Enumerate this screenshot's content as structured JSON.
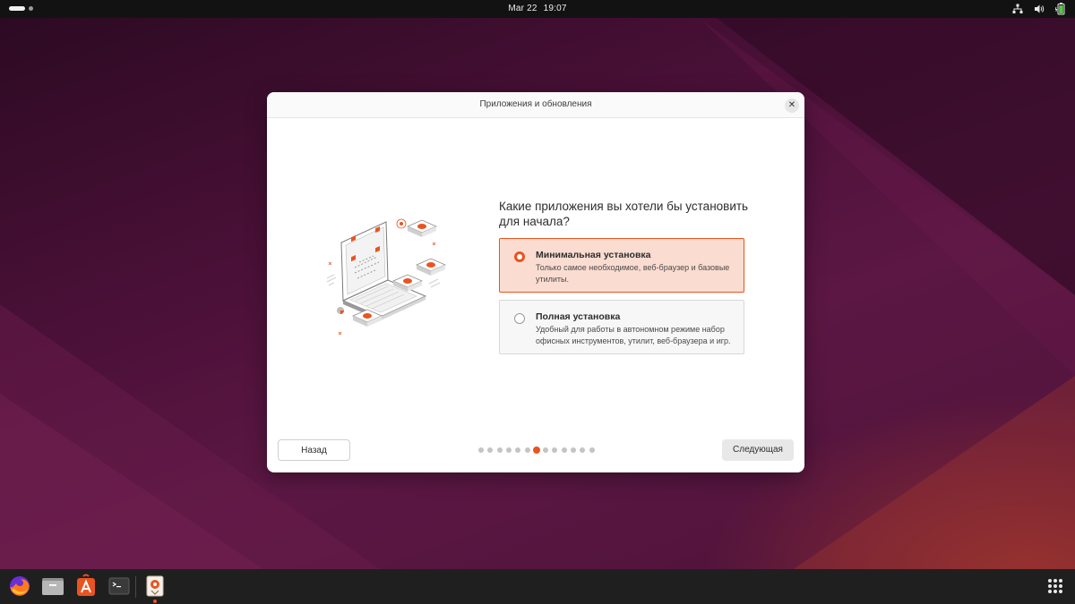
{
  "topbar": {
    "date": "Mar 22",
    "time": "19:07",
    "tray_icons": [
      "network-icon",
      "volume-icon",
      "battery-icon"
    ]
  },
  "dialog": {
    "title": "Приложения и обновления",
    "question": "Какие приложения вы хотели бы установить для начала?",
    "options": [
      {
        "title": "Минимальная установка",
        "description": "Только самое необходимое, веб-браузер и базовые утилиты.",
        "selected": true
      },
      {
        "title": "Полная установка",
        "description": "Удобный для работы в автономном режиме набор офисных инструментов, утилит, веб-браузера и игр.",
        "selected": false
      }
    ],
    "back_label": "Назад",
    "next_label": "Следующая",
    "pager": {
      "total": 13,
      "current": 7
    }
  },
  "dock": {
    "items": [
      "firefox-icon",
      "files-icon",
      "app-center-icon",
      "terminal-icon",
      "installer-icon"
    ],
    "apps-grid": "show-apps-icon"
  },
  "colors": {
    "accent": "#e95420",
    "selected_bg": "#fbdcd0",
    "topbar_bg": "#121212",
    "dock_bg": "#1f1f1f"
  }
}
